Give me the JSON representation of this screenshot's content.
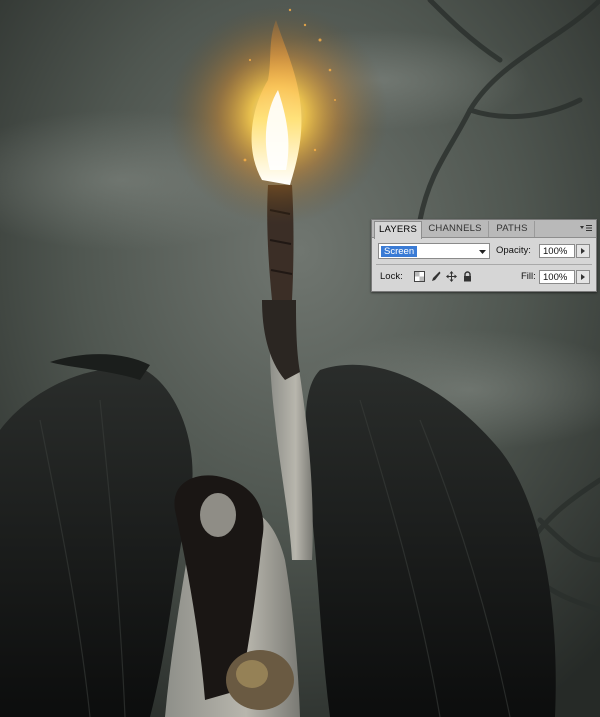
{
  "panel": {
    "tabs": [
      "LAYERS",
      "CHANNELS",
      "PATHS"
    ],
    "active_tab": "LAYERS",
    "blend_mode": "Screen",
    "opacity_label": "Opacity:",
    "opacity_value": "100%",
    "lock_label": "Lock:",
    "fill_label": "Fill:",
    "fill_value": "100%",
    "lock_icons": [
      "lock-transparent-pixels-icon",
      "lock-image-pixels-icon",
      "lock-position-icon",
      "lock-all-icon"
    ]
  },
  "scene": {
    "description_icons": [
      "torch-flame",
      "winged-figure"
    ]
  },
  "colors": {
    "highlight": "#3a7bd5",
    "panel_bg": "#d6d6d6",
    "flame": "#ffcf4a"
  }
}
